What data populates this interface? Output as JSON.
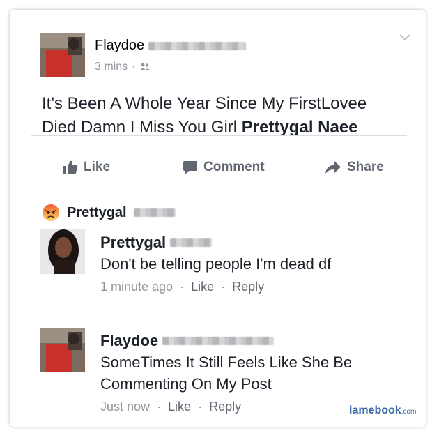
{
  "post": {
    "author": "Flaydoe",
    "time": "3 mins",
    "separator": "·",
    "text_plain": "It's Been A Whole Year Since My FirstLovee Died Damn I Miss You Girl ",
    "text_tag": "Prettygal Naee",
    "icons": {
      "menu": "chevron-down-icon",
      "audience": "friends-icon"
    }
  },
  "actions": {
    "like": "Like",
    "comment": "Comment",
    "share": "Share",
    "color": "#606770"
  },
  "reaction": {
    "emoji": "angry-face-icon",
    "name": "Prettygal"
  },
  "comments": [
    {
      "author": "Prettygal",
      "text": "Don't be telling people I'm dead df",
      "time": "1 minute ago",
      "like": "Like",
      "reply": "Reply"
    },
    {
      "author": "Flaydoe",
      "text": "SomeTimes It Still Feels Like She Be Commenting On My Post",
      "time": "Just now",
      "like": "Like",
      "reply": "Reply"
    }
  ],
  "meta_separator": "·",
  "watermark": {
    "main": "lamebook",
    "suffix": ".com"
  }
}
